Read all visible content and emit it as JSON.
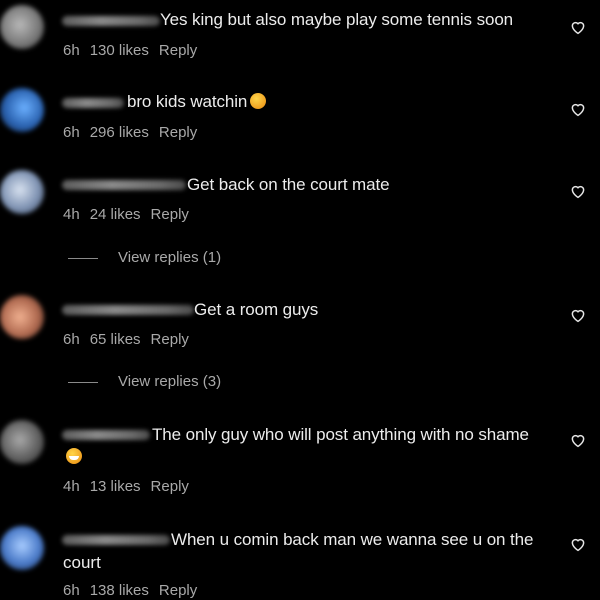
{
  "comments": [
    {
      "text": "Yes king but also maybe play some tennis soon",
      "time": "6h",
      "likes": "130 likes",
      "reply": "Reply",
      "avatar_color": "#8d8d8d"
    },
    {
      "text": "bro kids watchin",
      "emoji": "😂",
      "time": "6h",
      "likes": "296 likes",
      "reply": "Reply",
      "avatar_color": "#3a7fc8"
    },
    {
      "text": "Get back on the court mate",
      "time": "4h",
      "likes": "24 likes",
      "reply": "Reply",
      "view_replies": "View replies (1)",
      "avatar_color": "#8fa0b8"
    },
    {
      "text": "Get a room guys",
      "time": "6h",
      "likes": "65 likes",
      "reply": "Reply",
      "view_replies": "View replies (3)",
      "avatar_color": "#c08a70"
    },
    {
      "text": "The only guy who will post anything with no shame",
      "emoji": "😆",
      "time": "4h",
      "likes": "13 likes",
      "reply": "Reply",
      "avatar_color": "#707070"
    },
    {
      "text": "When u comin back man we wanna see u on the",
      "text_continued": "court",
      "time": "6h",
      "likes": "138 likes",
      "reply": "Reply",
      "avatar_color": "#5c8ad0"
    }
  ],
  "icons": {
    "like": "heart-outline-icon"
  }
}
